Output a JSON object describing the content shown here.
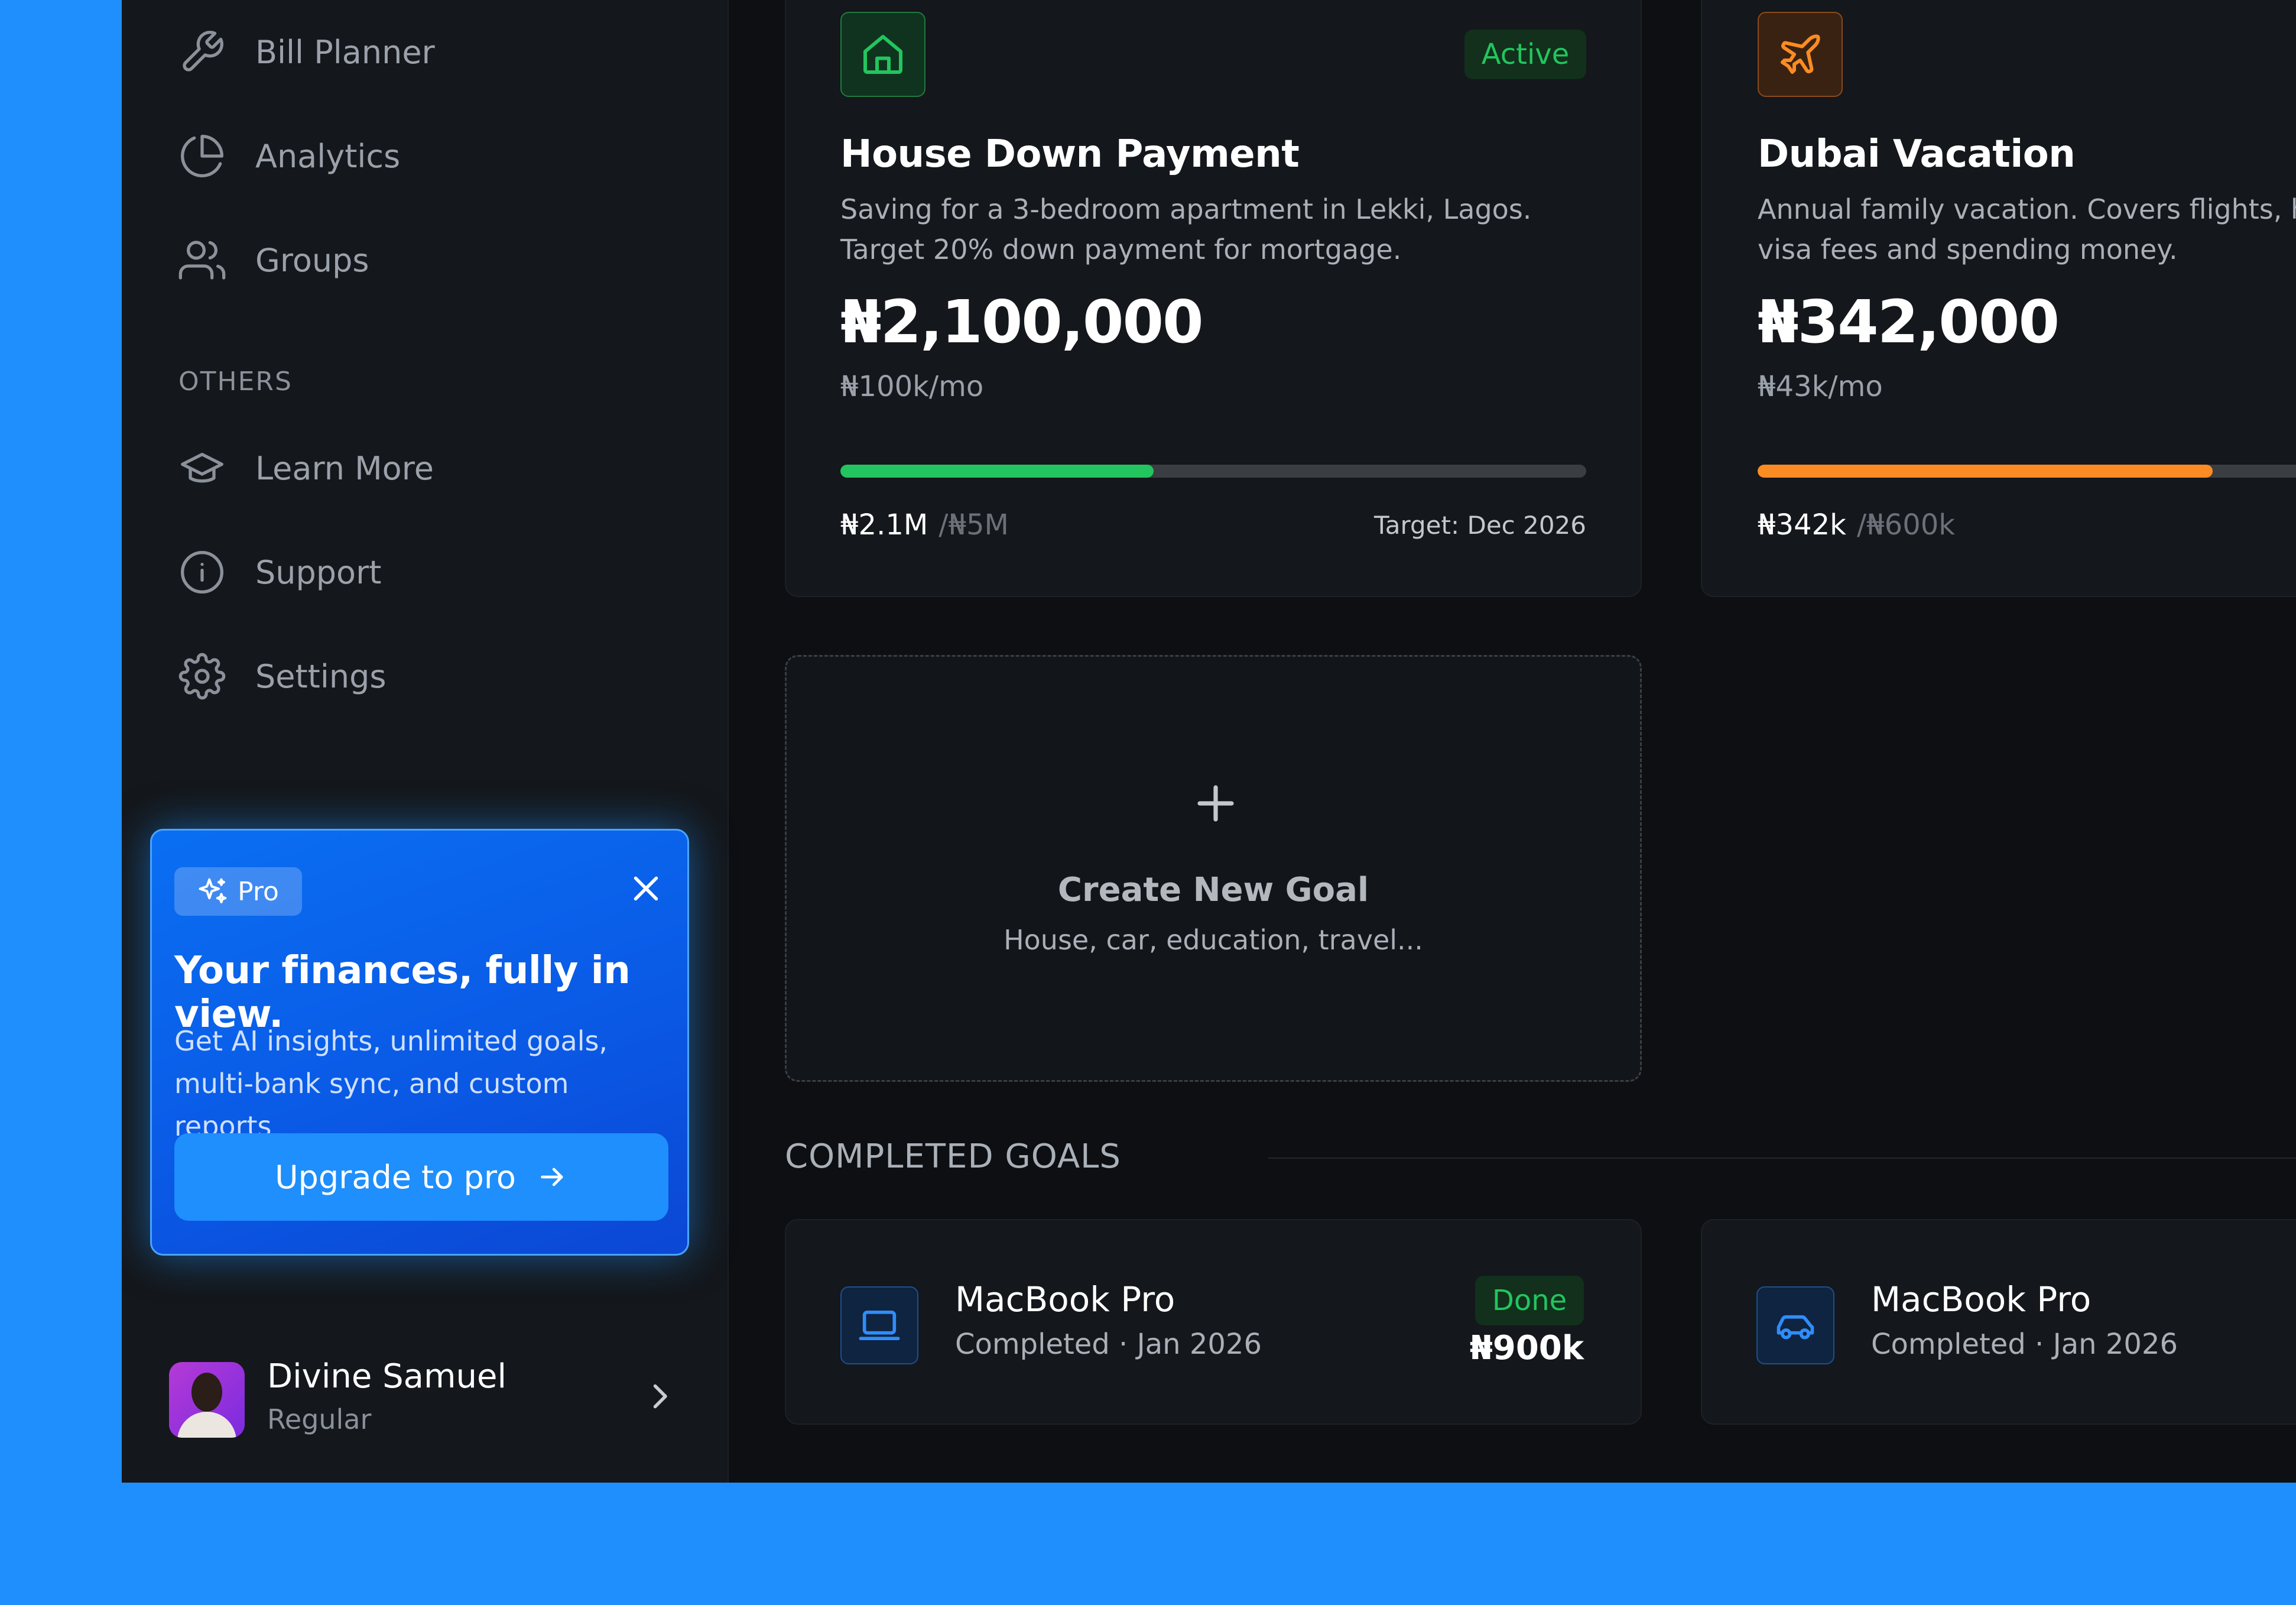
{
  "sidebar": {
    "items": [
      {
        "label": "Bill Planner",
        "icon": "wrench-icon"
      },
      {
        "label": "Analytics",
        "icon": "pie-chart-icon"
      },
      {
        "label": "Groups",
        "icon": "users-icon"
      }
    ],
    "others_label": "OTHERS",
    "others": [
      {
        "label": "Learn More",
        "icon": "graduation-cap-icon"
      },
      {
        "label": "Support",
        "icon": "info-icon"
      },
      {
        "label": "Settings",
        "icon": "gear-icon"
      }
    ],
    "pro": {
      "badge": "Pro",
      "title": "Your finances, fully in view.",
      "description": "Get AI insights, unlimited goals, multi-bank sync, and custom reports",
      "button": "Upgrade to pro"
    },
    "user": {
      "name": "Divine Samuel",
      "role": "Regular"
    }
  },
  "goals": [
    {
      "title": "House Down Payment",
      "status": "Active",
      "desc_line1": "Saving for a 3-bedroom apartment in Lekki, Lagos.",
      "desc_line2": "Target 20% down payment for mortgage.",
      "amount": "₦2,100,000",
      "monthly": "₦100k/mo",
      "saved": "₦2.1M",
      "target": "/₦5M",
      "target_date": "Target: Dec 2026",
      "progress": 0.42,
      "color": "#22c55e",
      "icon": "home-icon"
    },
    {
      "title": "Dubai Vacation",
      "desc_line1": "Annual family vacation. Covers flights, hotel,",
      "desc_line2": "visa fees and spending money.",
      "amount": "₦342,000",
      "monthly": "₦43k/mo",
      "saved": "₦342k",
      "target": "/₦600k",
      "progress": 0.57,
      "color": "#fb8c23",
      "icon": "plane-icon"
    }
  ],
  "create_goal": {
    "title": "Create New Goal",
    "subtitle": "House, car, education, travel..."
  },
  "completed": {
    "label": "COMPLETED GOALS",
    "items": [
      {
        "title": "MacBook Pro",
        "subtitle": "Completed · Jan 2026",
        "status": "Done",
        "amount": "₦900k",
        "icon": "laptop-icon"
      },
      {
        "title": "MacBook Pro",
        "subtitle": "Completed · Jan 2026",
        "icon": "car-icon"
      }
    ]
  }
}
